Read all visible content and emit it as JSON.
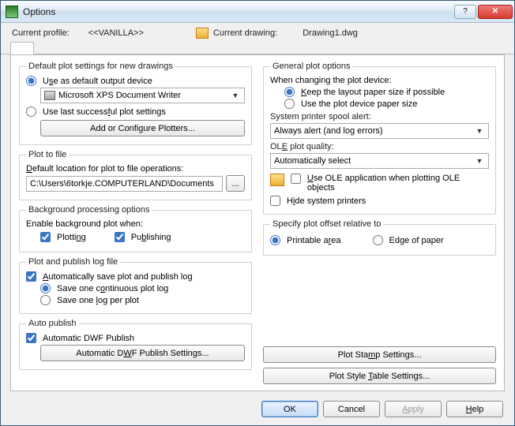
{
  "window": {
    "title": "Options"
  },
  "top": {
    "profile_label": "Current profile:",
    "profile_value": "<<VANILLA>>",
    "drawing_label": "Current drawing:",
    "drawing_value": "Drawing1.dwg"
  },
  "left": {
    "group_default": {
      "legend": "Default plot settings for new drawings",
      "radio_default_device": "Use as default output device",
      "device_value": "Microsoft XPS Document Writer",
      "radio_last_successful": "Use last successful plot settings",
      "btn_configure": "Add or Configure Plotters...",
      "underline_default_device": "s",
      "underline_last_successful": "F"
    },
    "group_plotfile": {
      "legend": "Plot to file",
      "label_default_loc_pre": "",
      "label_default_loc": "Default location for plot to file operations:",
      "path_value": "C:\\Users\\6torkje.COMPUTERLAND\\Documents",
      "browse": "..."
    },
    "group_bg": {
      "legend": "Background processing options",
      "enable_label": "Enable background plot when:",
      "plotting": "Plotting",
      "publishing": "Publishing"
    },
    "group_log": {
      "legend": "Plot and publish log file",
      "auto_save": "Automatically save plot and publish log",
      "one_continuous": "Save one continuous plot log",
      "one_per_plot": "Save one log per plot"
    },
    "group_auto": {
      "legend": "Auto publish",
      "auto_dwf": "Automatic DWF Publish",
      "btn_auto_dwf": "Automatic DWF Publish Settings..."
    }
  },
  "right": {
    "group_general": {
      "legend": "General plot options",
      "when_changing": "When changing the plot device:",
      "keep_layout": "Keep the layout paper size if possible",
      "use_device_size": "Use the plot device paper size",
      "spool_label": "System printer spool alert:",
      "spool_value": "Always alert (and log errors)",
      "ole_quality_label": "OLE plot quality:",
      "ole_quality_value": "Automatically select",
      "use_ole_app": "Use OLE application when plotting OLE objects",
      "hide_printers": "Hide system printers"
    },
    "group_offset": {
      "legend": "Specify plot offset relative to",
      "printable": "Printable area",
      "edge": "Edge of paper"
    },
    "btn_stamp": "Plot Stamp Settings...",
    "btn_style": "Plot Style Table Settings..."
  },
  "footer": {
    "ok": "OK",
    "cancel": "Cancel",
    "apply": "Apply",
    "help": "Help"
  }
}
